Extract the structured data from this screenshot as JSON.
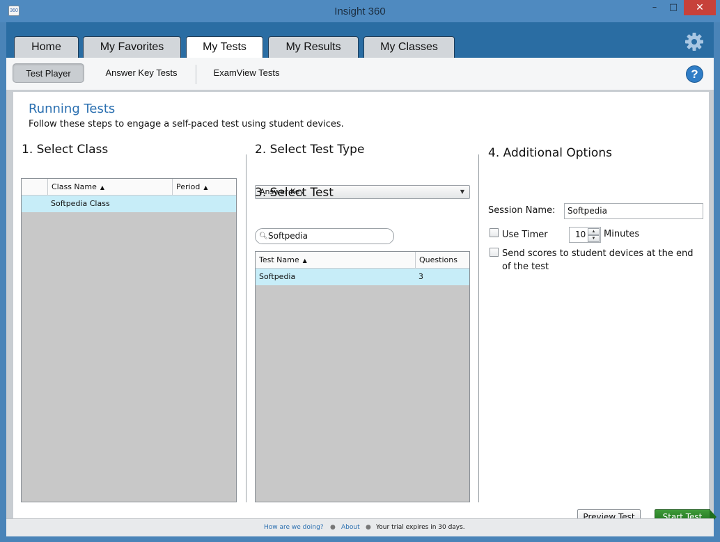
{
  "window": {
    "title": "Insight 360",
    "icon_text": "360",
    "minimize_glyph": "–",
    "maximize_glyph": "□",
    "close_glyph": "✕"
  },
  "tabs": [
    {
      "label": "Home"
    },
    {
      "label": "My Favorites"
    },
    {
      "label": "My Tests",
      "active": true
    },
    {
      "label": "My Results"
    },
    {
      "label": "My Classes"
    }
  ],
  "settings_icon": "gear-icon",
  "subtabs": [
    {
      "label": "Test Player",
      "active": true
    },
    {
      "label": "Answer Key Tests"
    },
    {
      "label": "ExamView Tests"
    }
  ],
  "help_glyph": "?",
  "page": {
    "title": "Running Tests",
    "subtitle": "Follow these steps to engage a self-paced test using student devices."
  },
  "step1": {
    "heading": "1. Select Class",
    "columns": [
      "Class Name",
      "Period"
    ],
    "rows": [
      {
        "class_name": "Softpedia Class",
        "period": ""
      }
    ]
  },
  "step2": {
    "heading": "2. Select Test Type",
    "selected": "Answer Key"
  },
  "step3": {
    "heading": "3. Select Test",
    "search_value": "Softpedia",
    "columns": [
      "Test Name",
      "Questions"
    ],
    "rows": [
      {
        "test_name": "Softpedia",
        "questions": "3"
      }
    ]
  },
  "step4": {
    "heading": "4. Additional Options",
    "session_label": "Session Name:",
    "session_value": "Softpedia",
    "use_timer_label": "Use Timer",
    "use_timer_checked": false,
    "timer_value": "10",
    "minutes_label": "Minutes",
    "send_scores_label_line1": "Send scores to student devices at the end",
    "send_scores_label_line2": "of the test",
    "send_scores_checked": false
  },
  "buttons": {
    "preview": "Preview Test",
    "start": "Start Test"
  },
  "footer": {
    "feedback_link": "How are we doing?",
    "about_link": "About",
    "trial_text": "Your trial expires in 30 days.",
    "separator": "●"
  },
  "colors": {
    "accent_blue": "#2a6da3",
    "title_blue": "#2a6fb0",
    "selected_row": "#c7edf8",
    "start_green": "#2e8a2a",
    "close_red": "#c7413a"
  }
}
